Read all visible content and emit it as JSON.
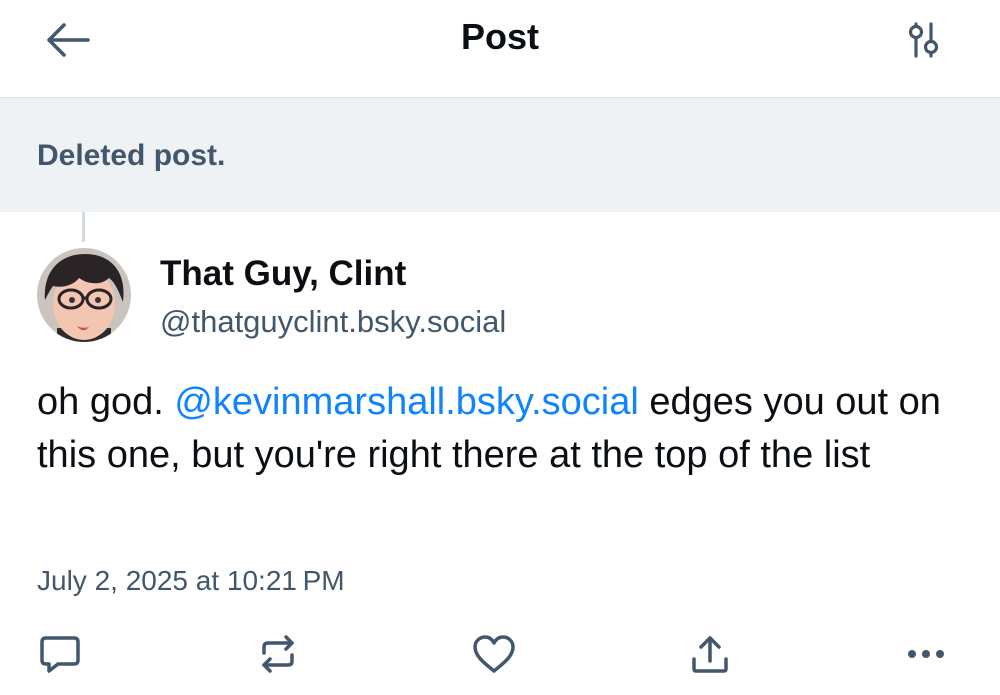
{
  "header": {
    "title": "Post",
    "back_icon": "arrow-left-icon",
    "filter_icon": "sliders-icon"
  },
  "parent": {
    "deleted_label": "Deleted post."
  },
  "post": {
    "author": {
      "display_name": "That Guy, Clint",
      "handle": "@thatguyclint.bsky.social",
      "avatar_icon": "avatar-illustration"
    },
    "text_before": "oh god. ",
    "mention": "@kevinmarshall.bsky.social",
    "text_after": " edges you out on this one, but you're right there at the top of the list",
    "timestamp": "July 2, 2025 at 10:21 PM"
  },
  "actions": [
    {
      "icon": "reply-icon"
    },
    {
      "icon": "repost-icon"
    },
    {
      "icon": "like-icon"
    },
    {
      "icon": "share-icon"
    },
    {
      "icon": "more-icon"
    }
  ],
  "colors": {
    "accent": "#1083fe",
    "secondary_text": "#42576c",
    "banner_bg": "#eff2f4",
    "icon": "#42576c"
  }
}
